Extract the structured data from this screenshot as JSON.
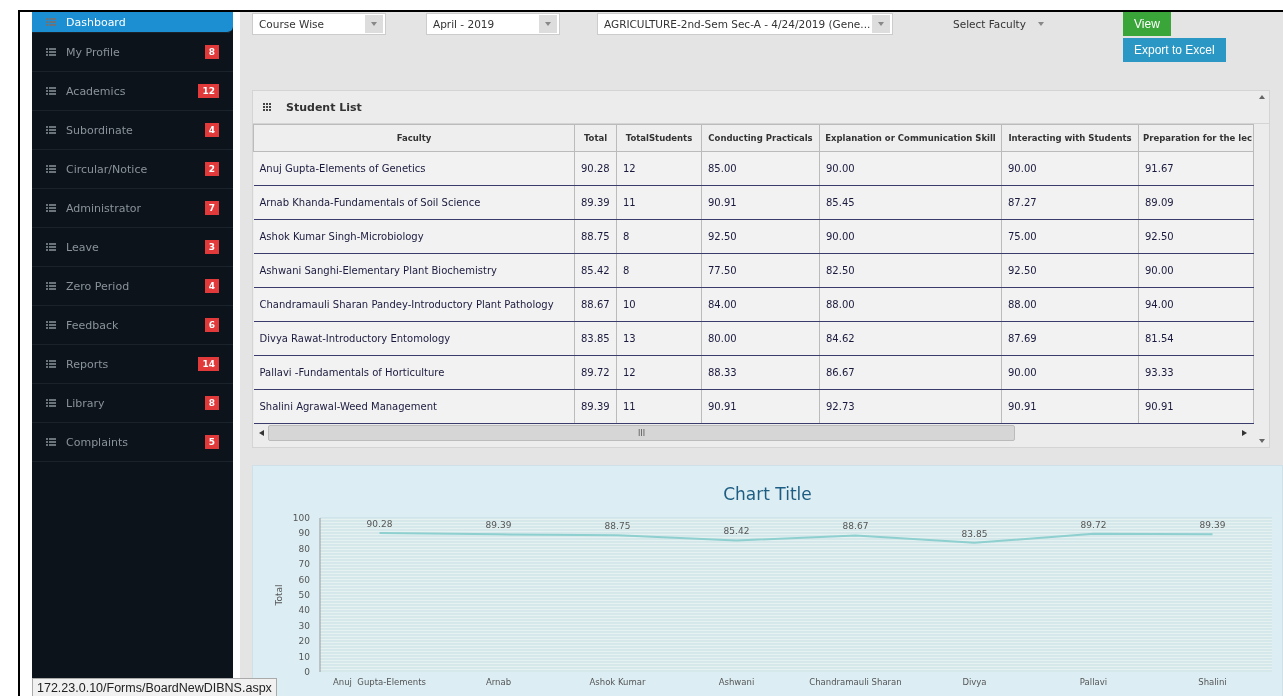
{
  "sidebar": {
    "items": [
      {
        "label": "Dashboard",
        "selected": true
      },
      {
        "label": "My Profile",
        "badge": "8",
        "selected": false
      },
      {
        "label": "Academics",
        "badge": "12",
        "selected": false
      },
      {
        "label": "Subordinate",
        "badge": "4",
        "selected": false
      },
      {
        "label": "Circular/Notice",
        "badge": "2",
        "selected": false
      },
      {
        "label": "Administrator",
        "badge": "7",
        "selected": false
      },
      {
        "label": "Leave",
        "badge": "3",
        "selected": false
      },
      {
        "label": "Zero Period",
        "badge": "4",
        "selected": false
      },
      {
        "label": "Feedback",
        "badge": "6",
        "selected": false
      },
      {
        "label": "Reports",
        "badge": "14",
        "selected": false
      },
      {
        "label": "Library",
        "badge": "8",
        "selected": false
      },
      {
        "label": "Complaints",
        "badge": "5",
        "selected": false
      }
    ]
  },
  "filters": [
    {
      "kind": "dropdown",
      "value": "Course Wise"
    },
    {
      "kind": "dropdown",
      "value": "April - 2019"
    },
    {
      "kind": "dropdown",
      "value": "AGRICULTURE-2nd-Sem Sec-A - 4/24/2019 (Gene..."
    },
    {
      "kind": "plain",
      "value": "Select Faculty"
    }
  ],
  "buttons": [
    {
      "kind": "view",
      "label": "View"
    },
    {
      "kind": "export",
      "label": "Export to Excel"
    }
  ],
  "student_list": {
    "title": "Student List",
    "columns": [
      "Faculty",
      "Total",
      "TotalStudents",
      "Conducting Practicals",
      "Explanation or Communication Skill",
      "Interacting with Students",
      "Preparation for the lec"
    ],
    "rows": [
      [
        "Anuj Gupta-Elements of Genetics",
        "90.28",
        "12",
        "85.00",
        "90.00",
        "90.00",
        "91.67"
      ],
      [
        "Arnab Khanda-Fundamentals of Soil Science",
        "89.39",
        "11",
        "90.91",
        "85.45",
        "87.27",
        "89.09"
      ],
      [
        "Ashok Kumar Singh-Microbiology",
        "88.75",
        "8",
        "92.50",
        "90.00",
        "75.00",
        "92.50"
      ],
      [
        "Ashwani Sanghi-Elementary Plant Biochemistry",
        "85.42",
        "8",
        "77.50",
        "82.50",
        "92.50",
        "90.00"
      ],
      [
        "Chandramauli Sharan Pandey-Introductory Plant Pathology",
        "88.67",
        "10",
        "84.00",
        "88.00",
        "88.00",
        "94.00"
      ],
      [
        "Divya Rawat-Introductory Entomology",
        "83.85",
        "13",
        "80.00",
        "84.62",
        "87.69",
        "81.54"
      ],
      [
        "Pallavi -Fundamentals of Horticulture",
        "89.72",
        "12",
        "88.33",
        "86.67",
        "90.00",
        "93.33"
      ],
      [
        "Shalini Agrawal-Weed Management",
        "89.39",
        "11",
        "90.91",
        "92.73",
        "90.91",
        "90.91"
      ]
    ],
    "scroll_grip": "III"
  },
  "chart": {
    "chart_data": {
      "type": "line",
      "title": "Chart Title",
      "ylabel": "Total",
      "categories": [
        "Anuj  Gupta-Elements",
        "Arnab",
        "Ashok Kumar",
        "Ashwani",
        "Chandramauli Sharan",
        "Divya",
        "Pallavi",
        "Shalini"
      ],
      "grid": true,
      "series": [
        {
          "color": "#8ecfcf",
          "values": [
            90.28,
            89.39,
            88.75,
            85.42,
            88.67,
            83.85,
            89.72,
            89.39
          ]
        }
      ],
      "ylim": [
        0,
        100
      ],
      "yticks": [
        0,
        10,
        20,
        30,
        40,
        50,
        60,
        70,
        80,
        90,
        100
      ],
      "data_labels": true
    }
  },
  "status_bar": {
    "url": "172.23.0.10/Forms/BoardNewDIBNS.aspx"
  }
}
